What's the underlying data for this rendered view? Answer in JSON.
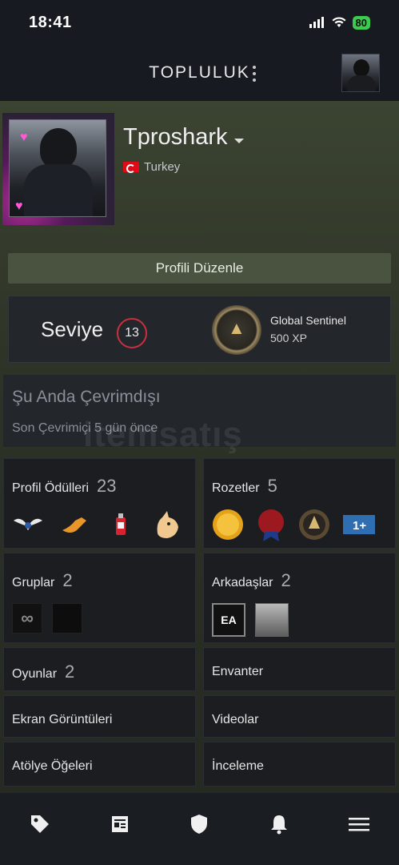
{
  "status": {
    "time": "18:41",
    "battery": "80"
  },
  "header": {
    "title": "TOPLULUK"
  },
  "profile": {
    "username": "Tproshark",
    "country": "Turkey",
    "edit_button": "Profili Düzenle"
  },
  "level": {
    "label": "Seviye",
    "value": "13",
    "badge_name": "Global Sentinel",
    "badge_xp": "500 XP"
  },
  "online_status": {
    "main": "Şu Anda Çevrimdışı",
    "sub": "Son Çevrimiçi 5 gün önce",
    "watermark": "itemsatış"
  },
  "tiles": {
    "profile_awards": {
      "label": "Profil Ödülleri",
      "count": "23"
    },
    "badges": {
      "label": "Rozetler",
      "count": "5"
    },
    "groups": {
      "label": "Gruplar",
      "count": "2"
    },
    "friends": {
      "label": "Arkadaşlar",
      "count": "2"
    },
    "games": {
      "label": "Oyunlar",
      "count": "2"
    },
    "inventory": {
      "label": "Envanter"
    },
    "screenshots": {
      "label": "Ekran Görüntüleri"
    },
    "videos": {
      "label": "Videolar"
    },
    "workshop": {
      "label": "Atölye Öğeleri"
    },
    "reviews": {
      "label": "İnceleme"
    },
    "friend_ea": "EA",
    "badge_1plus": "1+"
  },
  "colors": {
    "accent_level": "#c9303f",
    "background": "#1b1e24",
    "profile_bg": "#3b4331"
  }
}
